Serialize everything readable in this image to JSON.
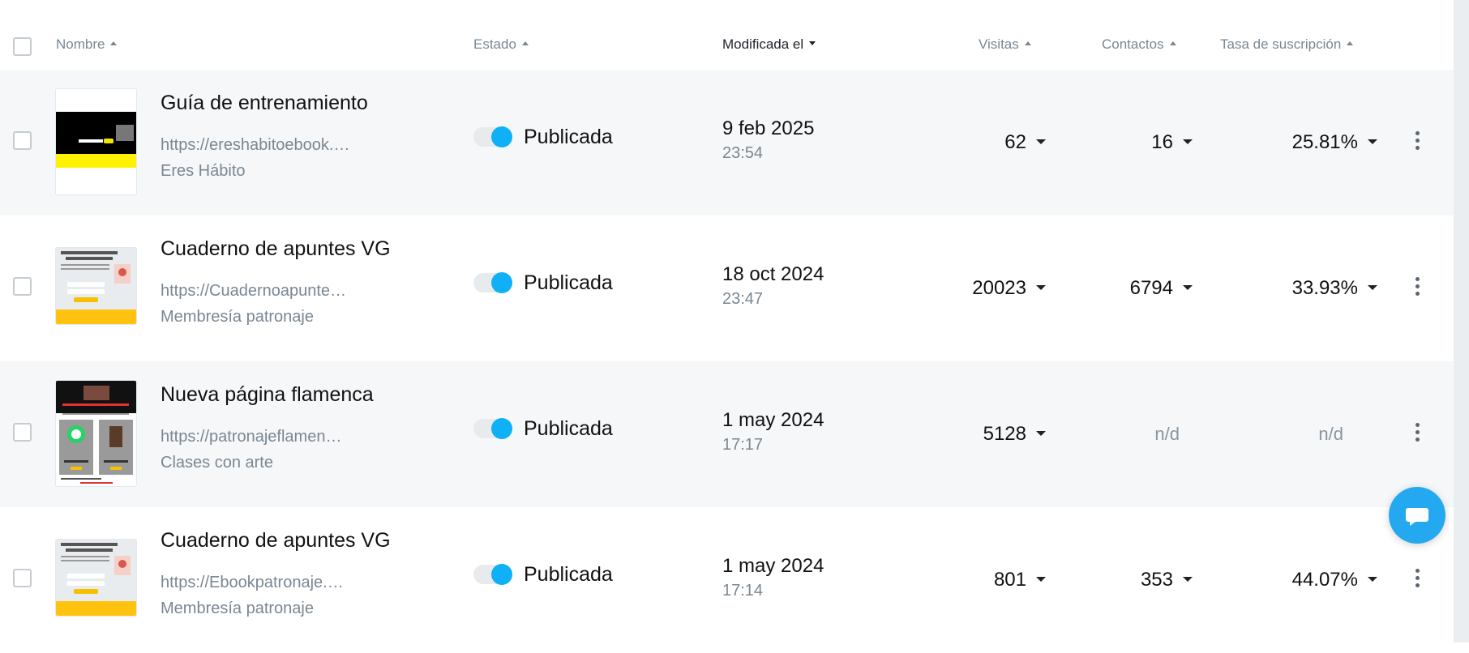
{
  "header": {
    "col_name": "Nombre",
    "col_status": "Estado",
    "col_modified": "Modificada el",
    "col_visits": "Visitas",
    "col_contacts": "Contactos",
    "col_rate": "Tasa de suscripción"
  },
  "rows": [
    {
      "title": "Guía de entrenamiento",
      "url": "https://ereshabitoebook.…",
      "subtitle": "Eres Hábito",
      "status": "Publicada",
      "published": true,
      "date": "9 feb 2025",
      "time": "23:54",
      "visits": "62",
      "contacts": "16",
      "rate": "25.81%"
    },
    {
      "title": "Cuaderno de apuntes VG",
      "url": "https://Cuadernoapunte…",
      "subtitle": "Membresía patronaje",
      "status": "Publicada",
      "published": true,
      "date": "18 oct 2024",
      "time": "23:47",
      "visits": "20023",
      "contacts": "6794",
      "rate": "33.93%"
    },
    {
      "title": "Nueva página flamenca",
      "url": "https://patronajeflamen…",
      "subtitle": "Clases con arte",
      "status": "Publicada",
      "published": true,
      "date": "1 may 2024",
      "time": "17:17",
      "visits": "5128",
      "contacts": "n/d",
      "rate": "n/d"
    },
    {
      "title": "Cuaderno de apuntes VG",
      "url": "https://Ebookpatronaje.…",
      "subtitle": "Membresía patronaje",
      "status": "Publicada",
      "published": true,
      "date": "1 may 2024",
      "time": "17:14",
      "visits": "801",
      "contacts": "353",
      "rate": "44.07%"
    }
  ],
  "colors": {
    "toggle_on": "#0fb0f5",
    "row_alt_bg": "#f5f7f8",
    "muted_text": "#7a8793",
    "chat_button": "#24a9f0"
  }
}
